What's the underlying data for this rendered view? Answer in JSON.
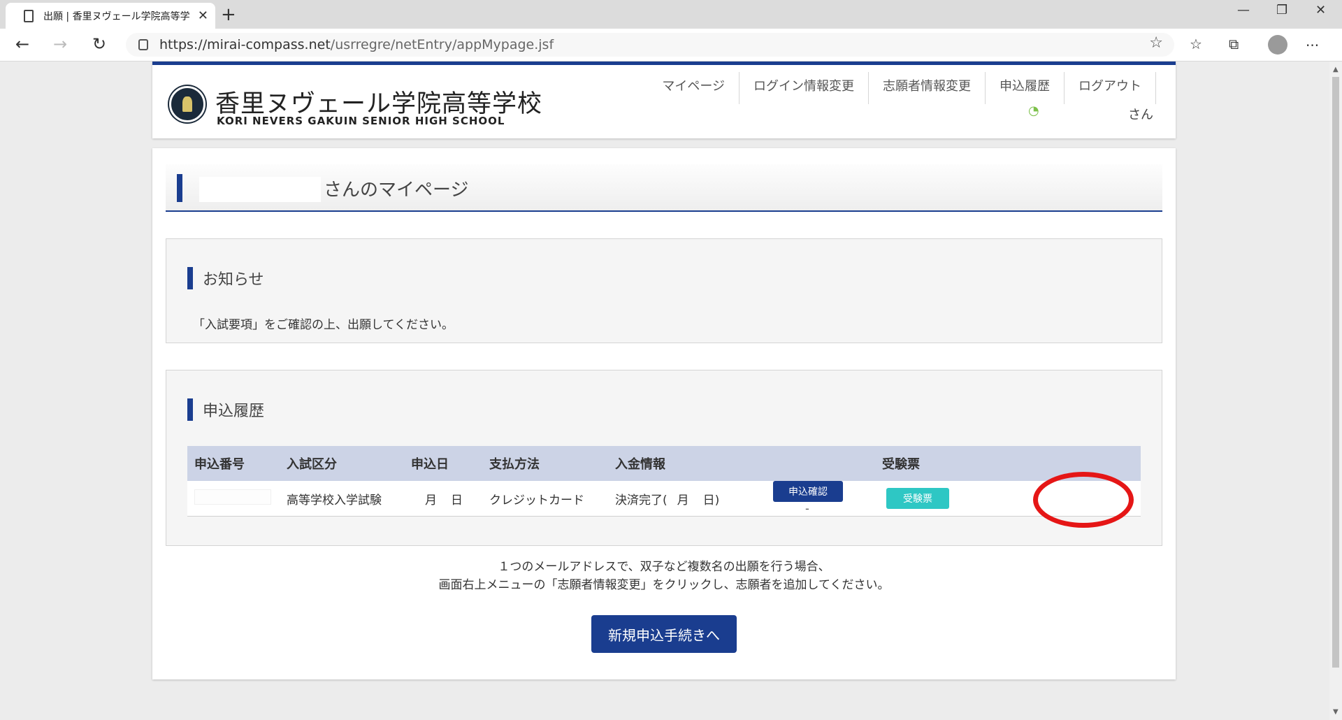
{
  "browser": {
    "tab_title": "出願 | 香里ヌヴェール学院高等学",
    "tab_close": "✕",
    "new_tab": "+",
    "url_host": "https://mirai-compass.net",
    "url_path": "/usrregre/netEntry/appMypage.jsf",
    "minimize": "—",
    "restore": "❐",
    "close": "✕",
    "back": "←",
    "forward": "→",
    "refresh": "↻",
    "favorite": "☆",
    "favorites_list": "☆",
    "collections": "⧉",
    "more": "···",
    "icons": [
      "page-icon",
      "lock-icon",
      "star-icon",
      "profile-icon"
    ]
  },
  "header": {
    "school_name": "香里ヌヴェール学院高等学校",
    "school_name_en": "KORI NEVERS GAKUIN SENIOR HIGH SCHOOL",
    "nav": [
      {
        "label": "マイページ"
      },
      {
        "label": "ログイン情報変更"
      },
      {
        "label": "志願者情報変更"
      },
      {
        "label": "申込履歴"
      },
      {
        "label": "ログアウト"
      }
    ],
    "user_suffix": "さん"
  },
  "main": {
    "page_title": "さんのマイページ",
    "notice": {
      "title": "お知らせ",
      "text": "「入試要項」をご確認の上、出願してください。"
    },
    "history": {
      "title": "申込履歴",
      "columns": [
        "申込番号",
        "入試区分",
        "申込日",
        "支払方法",
        "入金情報",
        "",
        "受験票"
      ],
      "rows": [
        {
          "exam_type": "高等学校入学試験",
          "date_month": "月",
          "date_day": "日",
          "payment_method": "クレジットカード",
          "payment_status_prefix": "決済完了(",
          "payment_status_month": "月",
          "payment_status_day": "日)",
          "confirm_label": "申込確認",
          "dash": "-",
          "ticket_label": "受験票"
        }
      ]
    },
    "info_line1": "１つのメールアドレスで、双子など複数名の出願を行う場合、",
    "info_line2": "画面右上メニューの「志願者情報変更」をクリックし、志願者を追加してください。",
    "new_application_label": "新規申込手続きへ"
  },
  "colors": {
    "brand_navy": "#1a3d8f",
    "ticket_teal": "#2ec7c4",
    "highlight_red": "#e51616",
    "table_header": "#ccd3e6"
  }
}
